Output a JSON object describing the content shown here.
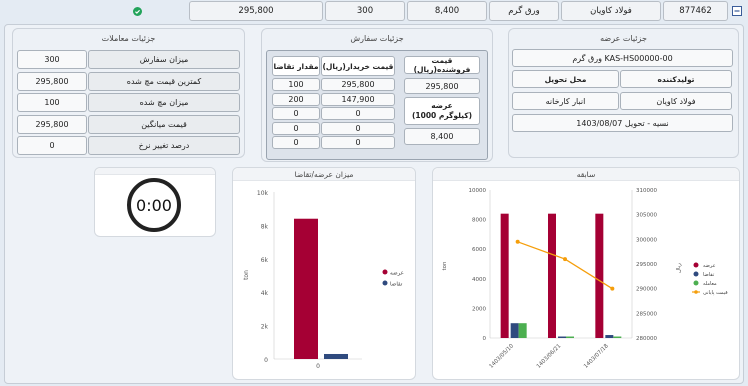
{
  "topbar": {
    "id": "877462",
    "name": "فولاد کاویان",
    "type": "ورق گرم",
    "v1": "8,400",
    "v2": "300",
    "v3": "295,800"
  },
  "trans": {
    "title": "جزئیات معاملات",
    "rows": [
      {
        "label": "میزان سفارش",
        "value": "300"
      },
      {
        "label": "کمترین قیمت مچ شده",
        "value": "295,800"
      },
      {
        "label": "میزان مچ شده",
        "value": "100"
      },
      {
        "label": "قیمت میانگین",
        "value": "295,800"
      },
      {
        "label": "درصد تغییر نرخ",
        "value": "0"
      }
    ]
  },
  "order": {
    "title": "جزئیات سفارش",
    "sell_header": "قیمت فروشنده(ریال)",
    "sell_price": "295,800",
    "supply_header": "عرضه\n(1000 کیلوگرم)",
    "supply_value": "8,400",
    "buy_header": "قیمت خریدار(ریال)",
    "qty_header": "مقدار تقاضا",
    "rows": [
      {
        "price": "295,800",
        "qty": "100"
      },
      {
        "price": "147,900",
        "qty": "200"
      },
      {
        "price": "0",
        "qty": "0"
      },
      {
        "price": "0",
        "qty": "0"
      },
      {
        "price": "0",
        "qty": "0"
      }
    ]
  },
  "offer": {
    "title": "جزئیات عرضه",
    "product": "ورق گرم KAS-HS00000-00",
    "producer_label": "تولیدکننده",
    "delivery_label": "محل تحویل",
    "producer": "فولاد کاویان",
    "delivery": "انبار کارخانه",
    "terms": "نسیه - تحویل 1403/08/07"
  },
  "timer": {
    "value": "0:00"
  },
  "supply_chart": {
    "title": "میزان عرضه/تقاضا"
  },
  "history_chart": {
    "title": "سابقه"
  },
  "chart_data": [
    {
      "type": "bar",
      "title": "میزان عرضه/تقاضا",
      "categories": [
        "0"
      ],
      "ylim": [
        0,
        10000
      ],
      "yticks": [
        "0",
        "2k",
        "4k",
        "6k",
        "8k",
        "10k"
      ],
      "ylabel": "ton",
      "legend": "right",
      "series": [
        {
          "name": "عرضه",
          "values": [
            8400
          ],
          "color": "#a50034"
        },
        {
          "name": "تقاضا",
          "values": [
            300
          ],
          "color": "#2f4a7e"
        }
      ]
    },
    {
      "type": "bar",
      "title": "سابقه",
      "categories": [
        "1403/05/10",
        "1403/06/21",
        "1403/07/18"
      ],
      "ylim": [
        0,
        10000
      ],
      "yticks": [
        "0",
        "2000",
        "4000",
        "6000",
        "8000",
        "10000"
      ],
      "y2lim": [
        280000,
        310000
      ],
      "y2ticks": [
        "280000",
        "285000",
        "290000",
        "295000",
        "300000",
        "305000",
        "310000"
      ],
      "ylabel": "ton",
      "y2label": "ریال",
      "legend": "right",
      "series": [
        {
          "name": "عرضه",
          "values": [
            8400,
            8400,
            8400
          ],
          "color": "#a50034"
        },
        {
          "name": "تقاضا",
          "values": [
            1000,
            100,
            200
          ],
          "color": "#2f4a7e"
        },
        {
          "name": "معامله",
          "values": [
            1000,
            100,
            100
          ],
          "color": "#4caf50"
        },
        {
          "name": "قیمت پایانی",
          "type": "line",
          "axis": "right",
          "values": [
            299500,
            296000,
            290000
          ],
          "color": "#f59e0b"
        }
      ]
    }
  ]
}
